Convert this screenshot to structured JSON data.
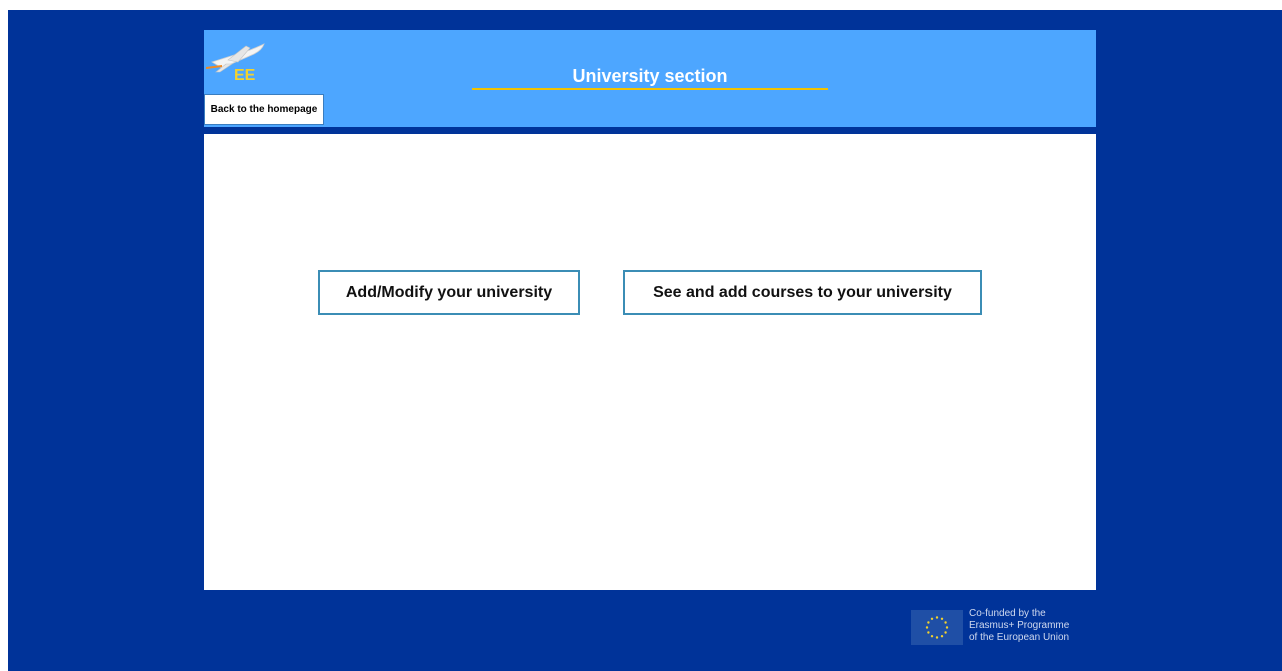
{
  "header": {
    "title": "University section",
    "back_label": "Back to the homepage",
    "logo_icon": "airplane-ee-logo-icon",
    "colors": {
      "page_background": "#003399",
      "header_background": "#4da6ff",
      "title_underline": "#f2c200",
      "button_border": "#3b8db5"
    }
  },
  "main": {
    "buttons": [
      {
        "label": "Add/Modify your university"
      },
      {
        "label": "See and add courses to your university"
      }
    ]
  },
  "footer": {
    "eu_icon": "eu-flag-icon",
    "cofunded_lines": [
      "Co-funded by the",
      "Erasmus+ Programme",
      "of the European Union"
    ]
  }
}
